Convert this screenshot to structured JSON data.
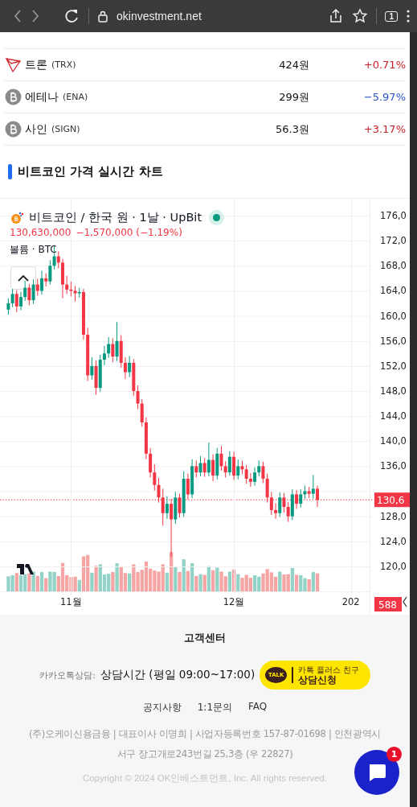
{
  "browser": {
    "url": "okinvestment.net",
    "tab_count": "1"
  },
  "coins": [
    {
      "kind": "tron",
      "name": "트론",
      "symbol": "(TRX)",
      "price": "424원",
      "change": "+0.71%",
      "color": "#c8202a"
    },
    {
      "kind": "generic",
      "name": "에테나",
      "symbol": "(ENA)",
      "price": "299원",
      "change": "−5.97%",
      "color": "#2a55c8"
    },
    {
      "kind": "generic",
      "name": "사인",
      "symbol": "(SIGN)",
      "price": "56.3원",
      "change": "+3.17%",
      "color": "#c8202a"
    }
  ],
  "section_title": "비트코인 가격 실시간 차트",
  "chart": {
    "title": "비트코인 / 한국 원 · 1날 · UpBit",
    "live": true,
    "price": "130,630,000",
    "change": "−1,570,000 (−1.19%)",
    "volume_label": "볼륨 · BTC",
    "last_price_tag": "130,6",
    "volume_tag": "588",
    "chart_data": {
      "type": "candlestick",
      "ylim": [
        115.5,
        178.7
      ],
      "grid": true,
      "yticks": [
        {
          "value": 176,
          "label": "176,0"
        },
        {
          "value": 172,
          "label": "172,0"
        },
        {
          "value": 168,
          "label": "168,0"
        },
        {
          "value": 164,
          "label": "164,0"
        },
        {
          "value": 160,
          "label": "160,0"
        },
        {
          "value": 156,
          "label": "156,0"
        },
        {
          "value": 152,
          "label": "152,0"
        },
        {
          "value": 148,
          "label": "148,0"
        },
        {
          "value": 144,
          "label": "144,0"
        },
        {
          "value": 140,
          "label": "140,0"
        },
        {
          "value": 136,
          "label": "136,0"
        },
        {
          "value": 128,
          "label": "128,0"
        },
        {
          "value": 124,
          "label": "124,0"
        },
        {
          "value": 120,
          "label": "120,0"
        }
      ],
      "categories": [
        null,
        null,
        null,
        null,
        null,
        null,
        null,
        null,
        null,
        null,
        null,
        null,
        null,
        null,
        null,
        "11월",
        null,
        null,
        null,
        null,
        null,
        null,
        null,
        null,
        null,
        null,
        null,
        null,
        null,
        null,
        null,
        null,
        null,
        null,
        null,
        null,
        null,
        null,
        null,
        null,
        null,
        null,
        null,
        null,
        null,
        null,
        null,
        null,
        null,
        null,
        null,
        null,
        null,
        null,
        "12월",
        null,
        null,
        null,
        null,
        null,
        null,
        null,
        null,
        null,
        null,
        null,
        null,
        null,
        null,
        null,
        null,
        null,
        null,
        null,
        null,
        null,
        null,
        null,
        null,
        null,
        null,
        null,
        "202",
        null,
        null,
        null,
        null
      ],
      "ohlc": [
        [
          161,
          162.8,
          160.2,
          162
        ],
        [
          162,
          164.3,
          161.4,
          163.5
        ],
        [
          163.5,
          164.1,
          160.6,
          161.5
        ],
        [
          161.5,
          163.8,
          160.9,
          163
        ],
        [
          163,
          165.6,
          162.4,
          164.5
        ],
        [
          164.5,
          165.1,
          161.7,
          162.5
        ],
        [
          162.5,
          165.8,
          161.9,
          165
        ],
        [
          165,
          165.9,
          163.2,
          164
        ],
        [
          164,
          167.2,
          163.4,
          166
        ],
        [
          166,
          166.8,
          164.7,
          165.5
        ],
        [
          165.5,
          168.9,
          165,
          168
        ],
        [
          168,
          171.2,
          167.4,
          169.5
        ],
        [
          169.5,
          170.3,
          167.6,
          168.5
        ],
        [
          168.5,
          169.1,
          162.8,
          165
        ],
        [
          165,
          166.4,
          163.5,
          164.2
        ],
        [
          164.2,
          165.5,
          163.1,
          164
        ],
        [
          164,
          164.8,
          162.3,
          163.6
        ],
        [
          163.6,
          164.5,
          162.9,
          163.8
        ],
        [
          163.8,
          164.3,
          156.2,
          157
        ],
        [
          157,
          158.1,
          149.6,
          150.5
        ],
        [
          150.5,
          153.4,
          149.8,
          152
        ],
        [
          152,
          152.9,
          147.4,
          148.5
        ],
        [
          148.5,
          153.8,
          147.9,
          153
        ],
        [
          153,
          155.2,
          152.1,
          154
        ],
        [
          154,
          156.6,
          153.3,
          155.5
        ],
        [
          155.5,
          156.4,
          152.6,
          153.5
        ],
        [
          153.5,
          159,
          152.8,
          156
        ],
        [
          156,
          156.9,
          151.7,
          152.5
        ],
        [
          152.5,
          153.4,
          149.9,
          151
        ],
        [
          151,
          153.6,
          150.2,
          152.5
        ],
        [
          152.5,
          153.1,
          147.2,
          148
        ],
        [
          148,
          148.9,
          145.1,
          146
        ],
        [
          146,
          146.7,
          142.3,
          143
        ],
        [
          143,
          143.8,
          137.1,
          138
        ],
        [
          138,
          138.9,
          134.2,
          135
        ],
        [
          135,
          136.3,
          132.1,
          133
        ],
        [
          133,
          134.1,
          130.2,
          131
        ],
        [
          131,
          132.4,
          126.5,
          128.5
        ],
        [
          128.5,
          131.2,
          127.6,
          130
        ],
        [
          130,
          130.8,
          121.5,
          127.5
        ],
        [
          127.5,
          131.9,
          126.8,
          131
        ],
        [
          131,
          131.6,
          127.8,
          128.5
        ],
        [
          128.5,
          135.2,
          127.9,
          134
        ],
        [
          134,
          134.8,
          130.7,
          131.5
        ],
        [
          131.5,
          137.1,
          130.9,
          136
        ],
        [
          136,
          136.9,
          134.2,
          135
        ],
        [
          135,
          137.6,
          134.4,
          136.5
        ],
        [
          136.5,
          137.3,
          134.3,
          135
        ],
        [
          135,
          139.8,
          134.4,
          137
        ],
        [
          137,
          137.9,
          133.6,
          134.5
        ],
        [
          134.5,
          138.9,
          133.9,
          138
        ],
        [
          138,
          139.2,
          135.3,
          136
        ],
        [
          136,
          136.8,
          134.2,
          135
        ],
        [
          135,
          138.4,
          134.5,
          137.5
        ],
        [
          137.5,
          138.3,
          133.8,
          134.5
        ],
        [
          134.5,
          137.1,
          133.9,
          136
        ],
        [
          136,
          136.9,
          134.7,
          135.5
        ],
        [
          135.5,
          136.2,
          133.2,
          134
        ],
        [
          134,
          134.9,
          132.7,
          133.5
        ],
        [
          133.5,
          135.8,
          132.9,
          135
        ],
        [
          135,
          136.9,
          134.4,
          136
        ],
        [
          136,
          136.7,
          133.3,
          134
        ],
        [
          134,
          134.8,
          130.2,
          131
        ],
        [
          131,
          131.9,
          128.2,
          129
        ],
        [
          129,
          130.1,
          127.6,
          128.5
        ],
        [
          128.5,
          131.8,
          127.9,
          131
        ],
        [
          131,
          131.7,
          128.6,
          129.5
        ],
        [
          129.5,
          130.3,
          127.1,
          128
        ],
        [
          128,
          132.3,
          127.4,
          131.5
        ],
        [
          131.5,
          132.2,
          129.2,
          130
        ],
        [
          130,
          132.3,
          129.4,
          131.5
        ],
        [
          131.5,
          132.9,
          130.8,
          132
        ],
        [
          132,
          132.7,
          130.9,
          131.6
        ],
        [
          131.6,
          134.6,
          130.8,
          132.4
        ],
        [
          132.4,
          132.9,
          129.5,
          130.63
        ],
        null,
        null,
        null,
        null,
        null,
        null,
        null,
        null,
        null,
        null,
        null,
        null
      ]
    }
  },
  "footer": {
    "title": "고객센터",
    "kakao_label": "카카오톡상담:",
    "hours": "상담시간 (평일 09:00~17:00)",
    "kakao_button": {
      "badge": "TALK",
      "line1": "카톡 플러스 친구",
      "line2": "상담신청"
    },
    "links": [
      "공지사항",
      "1:1문의",
      "FAQ"
    ],
    "company": "(주)오케이신용금융 | 대표이사 이명희 | 사업자등록번호 157-87-01698 | 인천광역시 서구 장고개로243번길 25,3층 (우 22827)",
    "copyright": "Copyright © 2024 OK인베스트먼트, Inc. All rights reserved."
  },
  "chat": {
    "badge": "1"
  }
}
